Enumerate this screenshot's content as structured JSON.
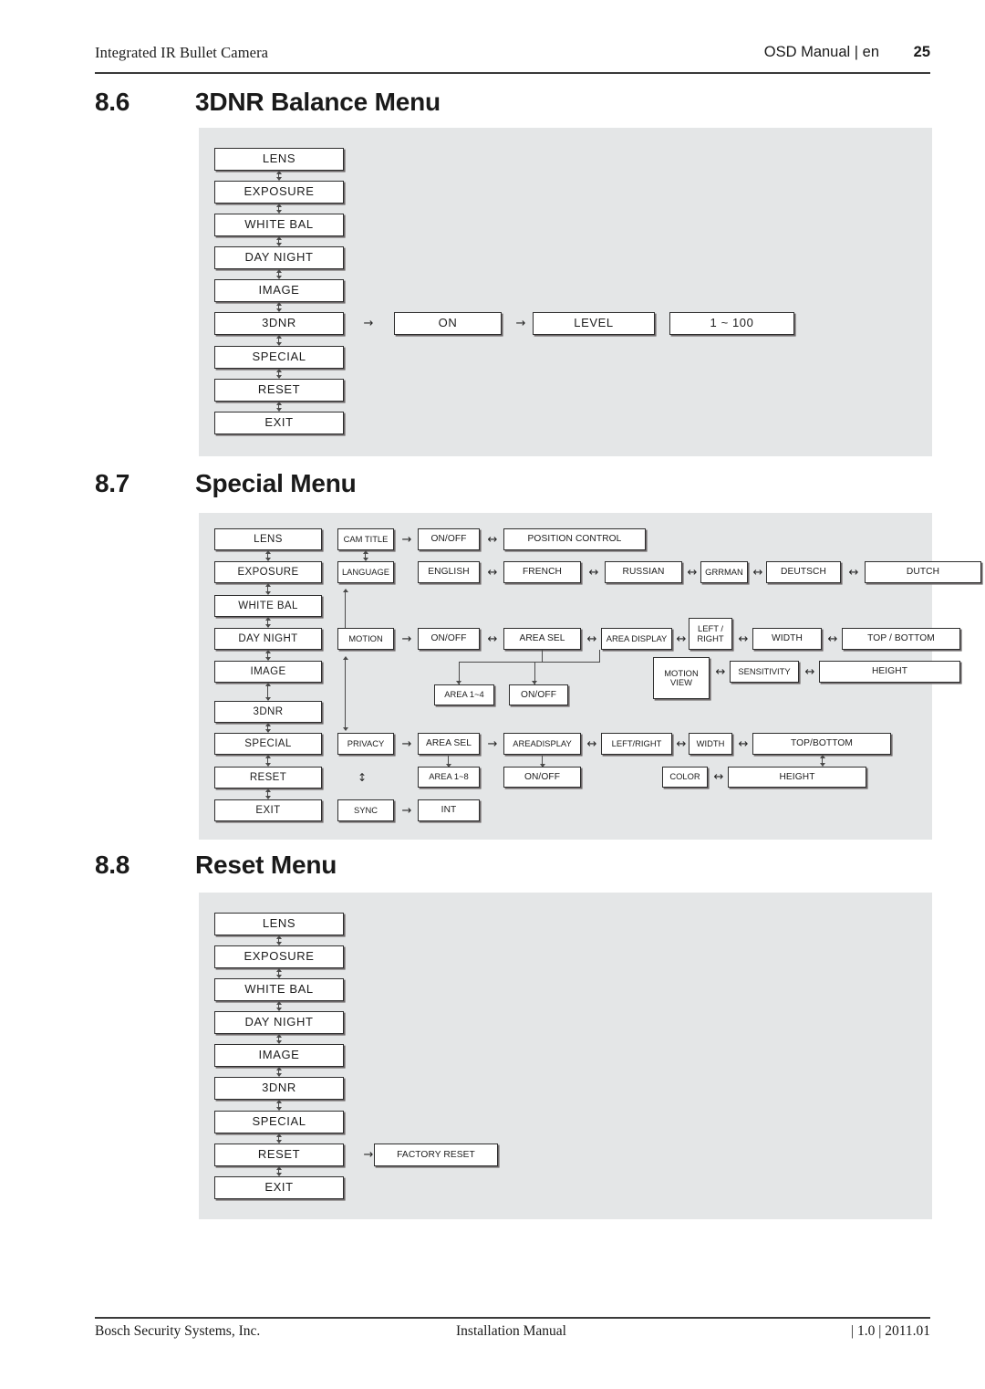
{
  "header": {
    "left": "Integrated IR Bullet Camera",
    "right": "OSD Manual | en",
    "page": "25"
  },
  "footer": {
    "left": "Bosch Security Systems, Inc.",
    "center": "Installation Manual",
    "right": "| 1.0 | 2011.01"
  },
  "sections": [
    {
      "number": "8.6",
      "title": "3DNR Balance Menu"
    },
    {
      "number": "8.7",
      "title": "Special Menu"
    },
    {
      "number": "8.8",
      "title": "Reset Menu"
    }
  ],
  "arrows": {
    "right": "→",
    "both_h": "↔",
    "both_v": "↕"
  },
  "main_menu": [
    "LENS",
    "EXPOSURE",
    "WHITE BAL",
    "DAY NIGHT",
    "IMAGE",
    "3DNR",
    "SPECIAL",
    "RESET",
    "EXIT"
  ],
  "dnr_menu": {
    "branch_row_index": 5,
    "branch": [
      "ON",
      "LEVEL",
      "1 ~ 100"
    ]
  },
  "reset_menu": {
    "branch_row_index": 7,
    "branch": [
      "FACTORY RESET"
    ]
  },
  "special_menu": {
    "cam_title": {
      "label": "CAM TITLE",
      "on_off": "ON/OFF",
      "position_control": "POSITION CONTROL"
    },
    "language": {
      "label": "LANGUAGE",
      "options": [
        "ENGLISH",
        "FRENCH",
        "RUSSIAN",
        "GRRMAN",
        "DEUTSCH",
        "DUTCH"
      ]
    },
    "motion": {
      "label": "MOTION",
      "on_off": "ON/OFF",
      "area_sel": "AREA SEL",
      "area_display": "AREA DISPLAY",
      "left_right": "LEFT /\nRIGHT",
      "width": "WIDTH",
      "top_bottom": "TOP / BOTTOM",
      "area_range": "AREA 1~4",
      "display_on_off": "ON/OFF",
      "motion_view": "MOTION\nVIEW",
      "sensitivity": "SENSITIVITY",
      "height": "HEIGHT"
    },
    "privacy": {
      "label": "PRIVACY",
      "area_sel": "AREA SEL",
      "area_display": "AREADISPLAY",
      "left_right": "LEFT/RIGHT",
      "width": "WIDTH",
      "top_bottom": "TOP/BOTTOM",
      "area_range": "AREA 1~8",
      "display_on_off": "ON/OFF",
      "color": "COLOR",
      "height": "HEIGHT"
    },
    "sync": {
      "label": "SYNC",
      "value": "INT"
    }
  }
}
